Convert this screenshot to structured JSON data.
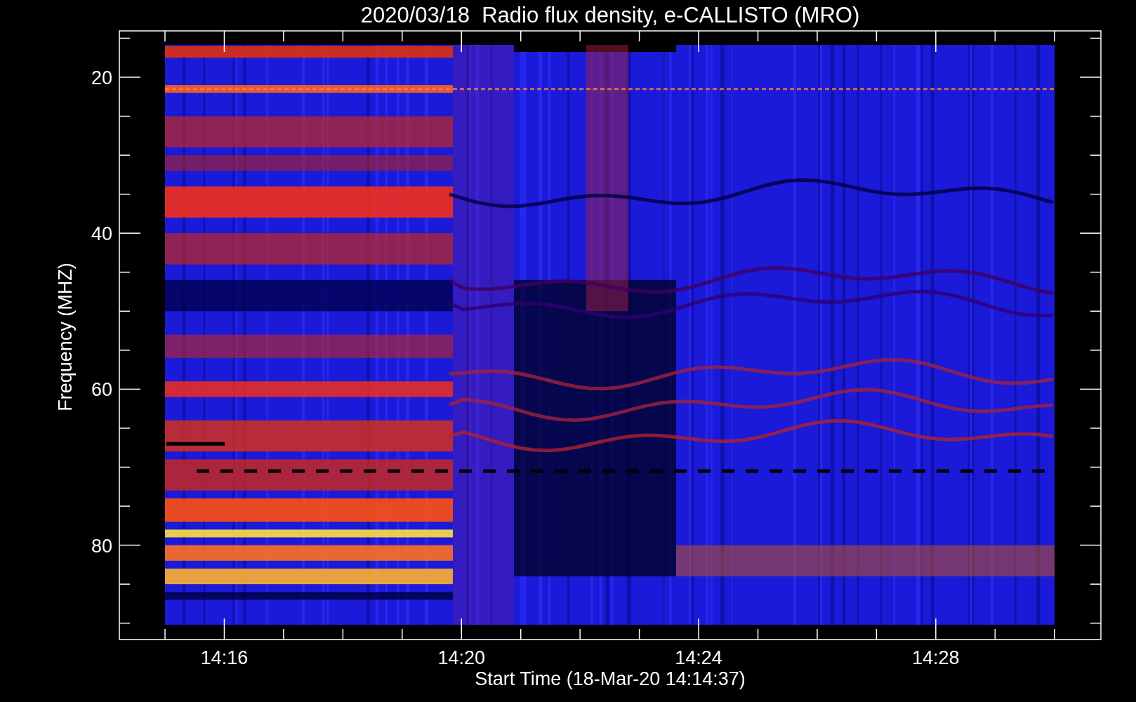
{
  "plot": {
    "title": "2020/03/18  Radio flux density, e-CALLISTO (MRO)",
    "y_axis": {
      "label": "Frequency (MHZ)",
      "ticks": [
        "20",
        "40",
        "60",
        "80"
      ]
    },
    "x_axis": {
      "label": "Start Time (18-Mar-20 14:14:37)",
      "ticks": [
        "14:16",
        "14:20",
        "14:24",
        "14:28"
      ]
    }
  }
}
